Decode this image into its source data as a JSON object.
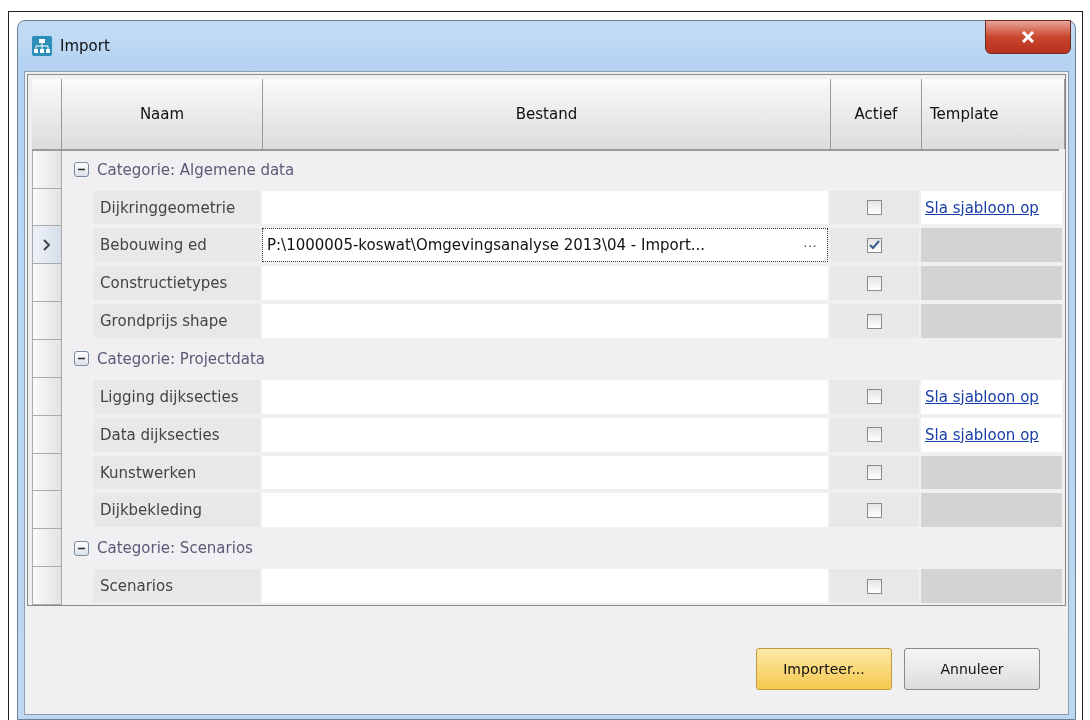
{
  "window": {
    "title": "Import"
  },
  "columns": [
    "Naam",
    "Bestand",
    "Actief",
    "Template"
  ],
  "categories": [
    {
      "label": "Categorie: Algemene data",
      "expanded": true,
      "rows": [
        {
          "name": "Dijkringgeometrie",
          "file": "",
          "active": false,
          "current": false,
          "template": {
            "kind": "link",
            "label": "Sla sjabloon op"
          }
        },
        {
          "name": "Bebouwing ed",
          "file": "P:\\1000005-koswat\\Omgevingsanalyse 2013\\04 - Import...",
          "browse": "···",
          "active": true,
          "current": true,
          "template": {
            "kind": "empty"
          }
        },
        {
          "name": "Constructietypes",
          "file": "",
          "active": false,
          "current": false,
          "template": {
            "kind": "empty"
          }
        },
        {
          "name": "Grondprijs shape",
          "file": "",
          "active": false,
          "current": false,
          "template": {
            "kind": "empty"
          }
        }
      ]
    },
    {
      "label": "Categorie: Projectdata",
      "expanded": true,
      "rows": [
        {
          "name": "Ligging dijksecties",
          "file": "",
          "active": false,
          "current": false,
          "template": {
            "kind": "link",
            "label": "Sla sjabloon op"
          }
        },
        {
          "name": "Data dijksecties",
          "file": "",
          "active": false,
          "current": false,
          "template": {
            "kind": "link",
            "label": "Sla sjabloon op"
          }
        },
        {
          "name": "Kunstwerken",
          "file": "",
          "active": false,
          "current": false,
          "template": {
            "kind": "empty"
          }
        },
        {
          "name": "Dijkbekleding",
          "file": "",
          "active": false,
          "current": false,
          "template": {
            "kind": "empty"
          }
        }
      ]
    },
    {
      "label": "Categorie: Scenarios",
      "expanded": true,
      "rows": [
        {
          "name": "Scenarios",
          "file": "",
          "active": false,
          "current": false,
          "template": {
            "kind": "empty"
          }
        }
      ]
    }
  ],
  "buttons": [
    {
      "label": "Importeer...",
      "default": true
    },
    {
      "label": "Annuleer",
      "default": false
    }
  ]
}
